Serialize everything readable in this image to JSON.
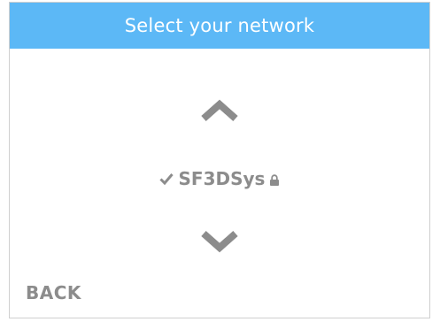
{
  "header": {
    "title": "Select your network"
  },
  "network": {
    "name": "SF3DSys",
    "selected": true,
    "secured": true
  },
  "icons": {
    "up": "chevron-up-icon",
    "down": "chevron-down-icon",
    "check": "checkmark-icon",
    "lock": "lock-icon"
  },
  "footer": {
    "back_label": "BACK"
  },
  "colors": {
    "header_bg": "#5cb8f6",
    "header_text": "#ffffff",
    "body_text": "#8c8c8c",
    "icon": "#8c8c8c"
  }
}
